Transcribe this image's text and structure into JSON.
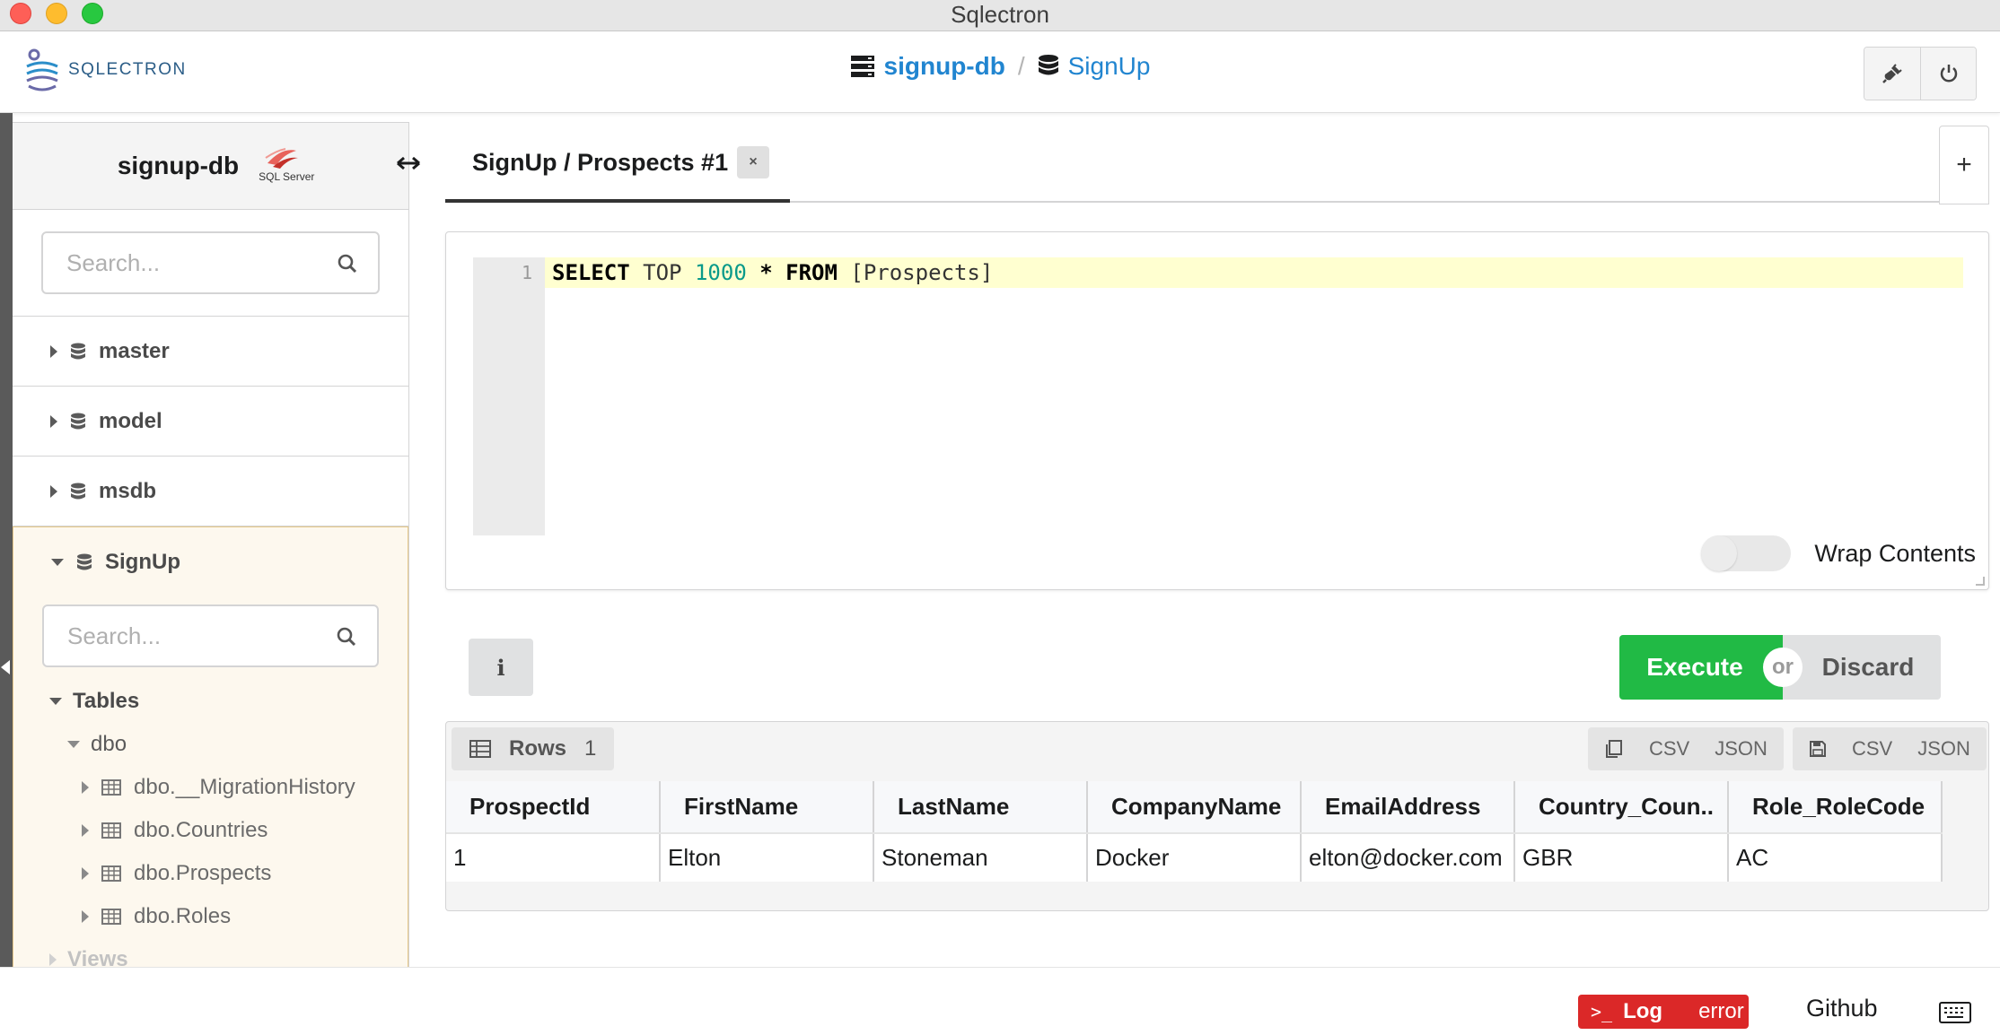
{
  "window": {
    "title": "Sqlectron"
  },
  "header": {
    "logo_text": "SQLECTRON",
    "server": "signup-db",
    "separator": "/",
    "database": "SignUp"
  },
  "sidebar": {
    "server_name": "signup-db",
    "server_type_label": "SQL Server",
    "search_placeholder": "Search...",
    "databases": [
      "master",
      "model",
      "msdb"
    ],
    "open_database": {
      "name": "SignUp",
      "search_placeholder": "Search...",
      "tables_label": "Tables",
      "schema": "dbo",
      "tables": [
        "dbo.__MigrationHistory",
        "dbo.Countries",
        "dbo.Prospects",
        "dbo.Roles"
      ],
      "views_label": "Views"
    }
  },
  "tabs": {
    "active": "SignUp / Prospects #1",
    "close_label": "×",
    "add_label": "+"
  },
  "editor": {
    "line_number": "1",
    "query": {
      "kw1": "SELECT",
      "top": "TOP",
      "limit": "1000",
      "star": "*",
      "kw2": "FROM",
      "table": "[Prospects]"
    },
    "wrap_label": "Wrap Contents",
    "wrap_enabled": false
  },
  "actions": {
    "info_label": "i",
    "execute_label": "Execute",
    "or_label": "or",
    "discard_label": "Discard"
  },
  "results": {
    "rows_label": "Rows",
    "rows_count": "1",
    "copy_csv": "CSV",
    "copy_json": "JSON",
    "save_csv": "CSV",
    "save_json": "JSON",
    "columns": [
      "ProspectId",
      "FirstName",
      "LastName",
      "CompanyName",
      "EmailAddress",
      "Country_Coun..",
      "Role_RoleCode"
    ],
    "rows": [
      [
        "1",
        "Elton",
        "Stoneman",
        "Docker",
        "elton@docker.com",
        "GBR",
        "AC"
      ]
    ]
  },
  "footer": {
    "log_label": "Log",
    "log_status": "error",
    "github_label": "Github"
  },
  "colors": {
    "accent": "#2185d0",
    "execute": "#21ba45",
    "error": "#db2828"
  }
}
